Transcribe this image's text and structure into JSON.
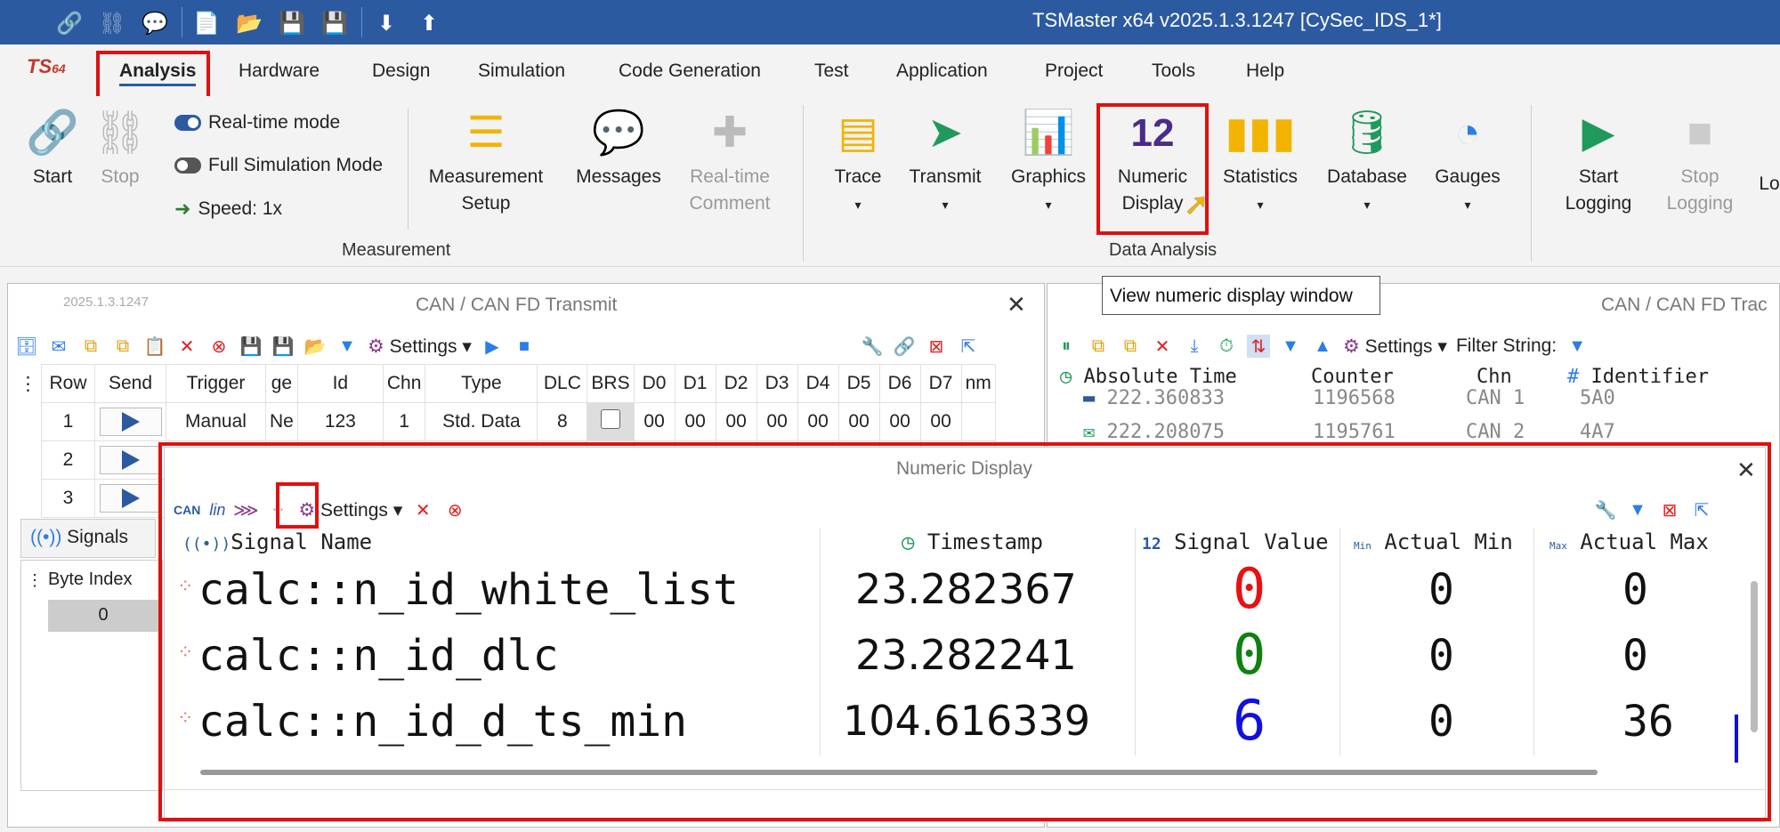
{
  "window": {
    "title": "TSMaster x64 v2025.1.3.1247 [CySec_IDS_1*]"
  },
  "menu": {
    "items": [
      "Analysis",
      "Hardware",
      "Design",
      "Simulation",
      "Code Generation",
      "Test",
      "Application",
      "Project",
      "Tools",
      "Help"
    ],
    "active": "Analysis"
  },
  "ribbon": {
    "start": "Start",
    "stop": "Stop",
    "realtime_mode": "Real-time mode",
    "full_sim_mode": "Full Simulation Mode",
    "speed": "Speed: 1x",
    "measurement_setup": [
      "Measurement",
      "Setup"
    ],
    "messages": "Messages",
    "realtime_comment": [
      "Real-time",
      "Comment"
    ],
    "group_measurement": "Measurement",
    "trace": "Trace",
    "transmit": "Transmit",
    "graphics": "Graphics",
    "numeric_display": [
      "Numeric",
      "Display"
    ],
    "statistics": "Statistics",
    "database": "Database",
    "gauges": "Gauges",
    "group_data_analysis": "Data Analysis",
    "start_logging": [
      "Start",
      "Logging"
    ],
    "stop_logging": [
      "Stop",
      "Logging"
    ],
    "lo": "Lo",
    "numeric_icon_text": "12"
  },
  "tooltip": "View numeric display window",
  "transmit_panel": {
    "version": "2025.1.3.1247",
    "title": "CAN / CAN FD Transmit",
    "settings": "Settings",
    "columns": [
      "Row",
      "Send",
      "Trigger",
      "ge",
      "Id",
      "Chn",
      "Type",
      "DLC",
      "BRS",
      "D0",
      "D1",
      "D2",
      "D3",
      "D4",
      "D5",
      "D6",
      "D7",
      "nm"
    ],
    "rows": [
      {
        "row": "1",
        "trigger": "Manual",
        "ge": "Ne",
        "id": "123",
        "chn": "1",
        "type": "Std. Data",
        "dlc": "8",
        "d": [
          "00",
          "00",
          "00",
          "00",
          "00",
          "00",
          "00",
          "00"
        ]
      },
      {
        "row": "2"
      },
      {
        "row": "3"
      }
    ],
    "signals_tab": "Signals",
    "byte_index_header": "Byte Index",
    "byte_index_value": "0"
  },
  "trace_panel": {
    "title": "CAN / CAN FD Trac",
    "settings": "Settings",
    "filter_label": "Filter String:",
    "columns": [
      "Absolute Time",
      "Counter",
      "Chn",
      "Identifier"
    ],
    "rows": [
      {
        "time": "222.360833",
        "counter": "1196568",
        "chn": "CAN 1",
        "id": "5A0"
      },
      {
        "time": "222.208075",
        "counter": "1195761",
        "chn": "CAN 2",
        "id": "4A7"
      }
    ]
  },
  "numeric_display": {
    "title": "Numeric Display",
    "settings": "Settings",
    "toolbar_icons": [
      "CAN",
      "lin"
    ],
    "columns": {
      "name": "Signal Name",
      "timestamp": "Timestamp",
      "value": "Signal Value",
      "min": "Actual Min",
      "max": "Actual Max"
    },
    "header_icons": {
      "value": "12",
      "min": "Min",
      "max": "Max"
    },
    "rows": [
      {
        "name": "calc::n_id_white_list",
        "timestamp": "23.282367",
        "value": "0",
        "min": "0",
        "max": "0",
        "color": "#e81010"
      },
      {
        "name": "calc::n_id_dlc",
        "timestamp": "23.282241",
        "value": "0",
        "min": "0",
        "max": "0",
        "color": "#108010"
      },
      {
        "name": "calc::n_id_d_ts_min",
        "timestamp": "104.616339",
        "value": "6",
        "min": "0",
        "max": "36",
        "color": "#1010e0"
      }
    ]
  }
}
